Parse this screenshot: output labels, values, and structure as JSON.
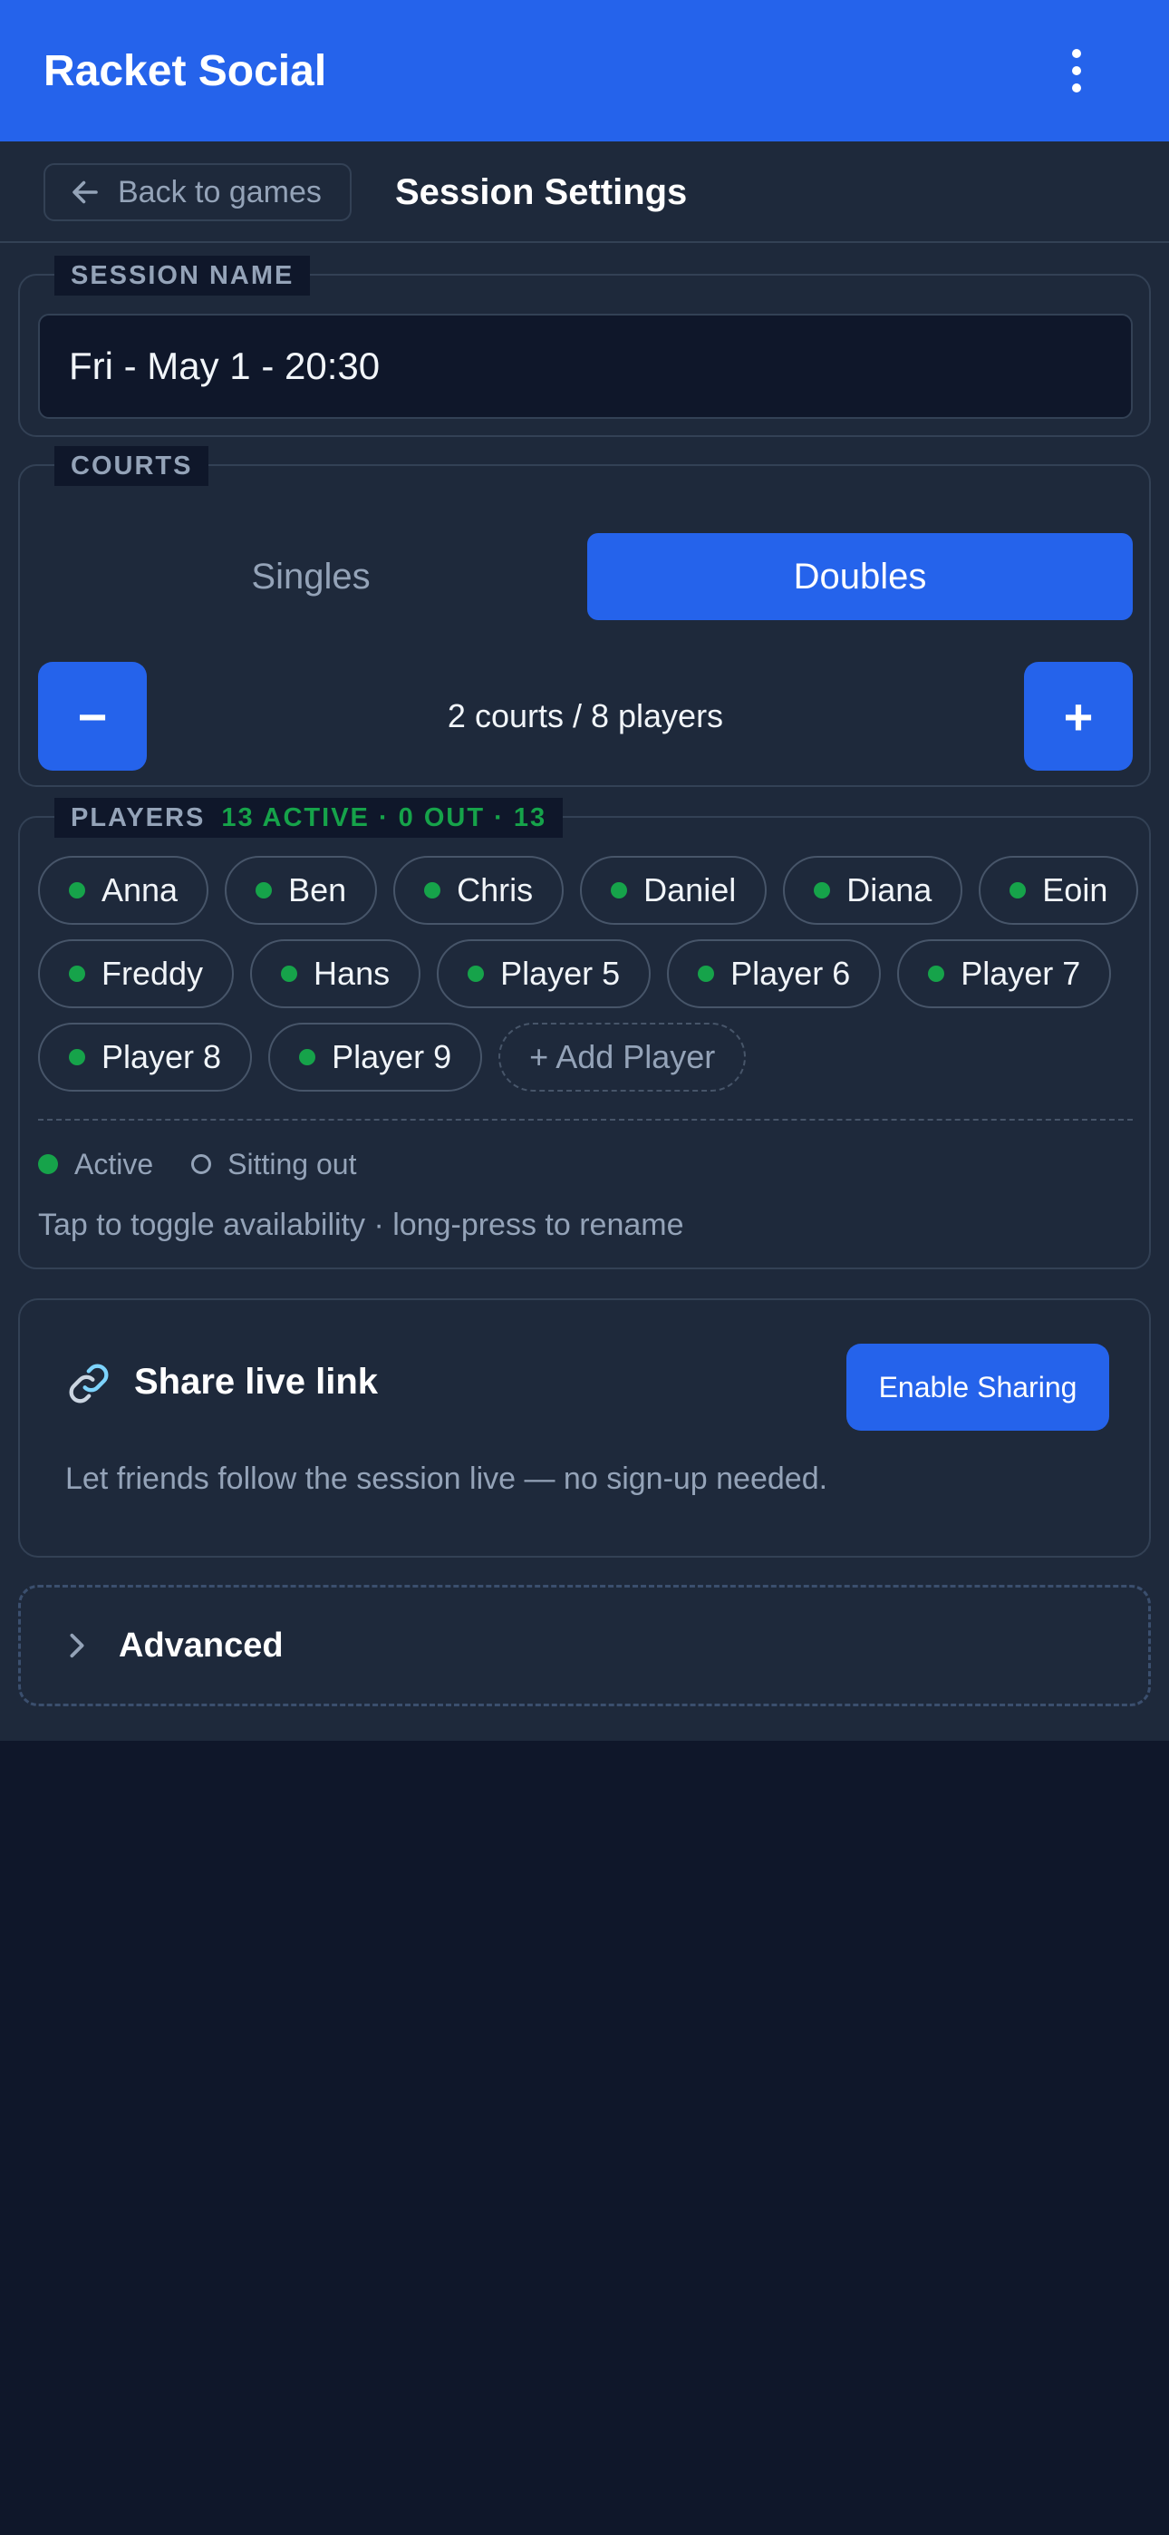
{
  "app": {
    "title": "Racket Social"
  },
  "subheader": {
    "back_label": "Back to games",
    "title": "Session Settings"
  },
  "session_name": {
    "legend": "SESSION NAME",
    "value": "Fri - May 1 - 20:30"
  },
  "courts": {
    "legend": "COURTS",
    "modes": [
      "Singles",
      "Doubles"
    ],
    "selected_mode": "Doubles",
    "decrement_label": "−",
    "increment_label": "+",
    "summary": "2 courts / 8 players"
  },
  "players": {
    "legend": "PLAYERS",
    "stats": "13 ACTIVE · 0 OUT · 13",
    "list": [
      {
        "name": "Anna",
        "status": "active"
      },
      {
        "name": "Ben",
        "status": "active"
      },
      {
        "name": "Chris",
        "status": "active"
      },
      {
        "name": "Daniel",
        "status": "active"
      },
      {
        "name": "Diana",
        "status": "active"
      },
      {
        "name": "Eoin",
        "status": "active"
      },
      {
        "name": "Freddy",
        "status": "active"
      },
      {
        "name": "Hans",
        "status": "active"
      },
      {
        "name": "Player 5",
        "status": "active"
      },
      {
        "name": "Player 6",
        "status": "active"
      },
      {
        "name": "Player 7",
        "status": "active"
      },
      {
        "name": "Player 8",
        "status": "active"
      },
      {
        "name": "Player 9",
        "status": "active"
      }
    ],
    "add_label": "+ Add Player",
    "legend_active": "Active",
    "legend_out": "Sitting out",
    "hint": "Tap to toggle availability · long-press to rename"
  },
  "share": {
    "icon": "link-icon",
    "title": "Share live link",
    "button_label": "Enable Sharing",
    "description": "Let friends follow the session live — no sign-up needed."
  },
  "advanced": {
    "label": "Advanced",
    "icon": "chevron-right-icon"
  },
  "colors": {
    "accent": "#2563eb",
    "active": "#16a34a",
    "surface": "#1e293b",
    "background": "#0f172a"
  }
}
